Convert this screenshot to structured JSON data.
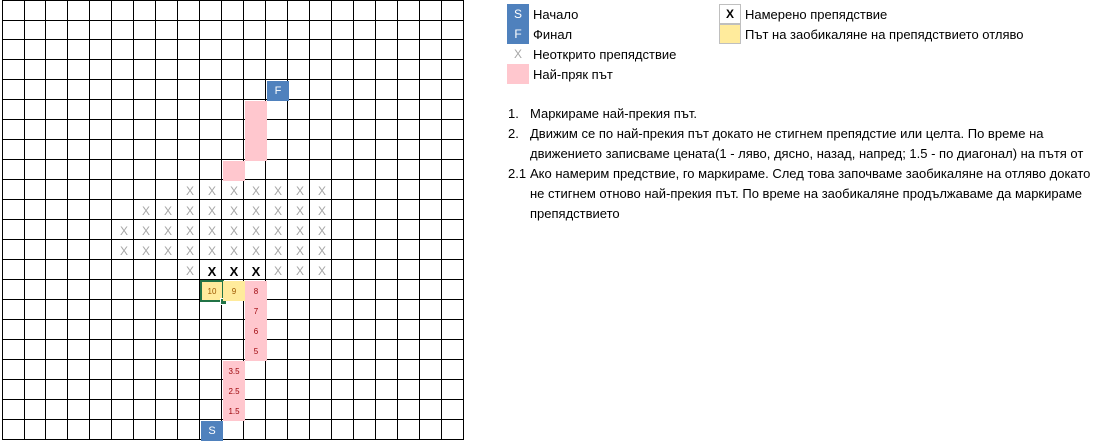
{
  "grid": {
    "rows": 22,
    "cols": 21,
    "cells": [
      {
        "row": 4,
        "col": 12,
        "kind": "end",
        "text": "F"
      },
      {
        "row": 5,
        "col": 11,
        "kind": "pink",
        "text": ""
      },
      {
        "row": 6,
        "col": 11,
        "kind": "pink",
        "text": ""
      },
      {
        "row": 7,
        "col": 11,
        "kind": "pink",
        "text": ""
      },
      {
        "row": 8,
        "col": 10,
        "kind": "pink",
        "text": ""
      },
      {
        "row": 9,
        "col": 8,
        "kind": "unknown",
        "text": "X"
      },
      {
        "row": 9,
        "col": 9,
        "kind": "unknown",
        "text": "X"
      },
      {
        "row": 9,
        "col": 10,
        "kind": "unknown",
        "text": "X"
      },
      {
        "row": 9,
        "col": 11,
        "kind": "unknown",
        "text": "X"
      },
      {
        "row": 9,
        "col": 12,
        "kind": "unknown",
        "text": "X"
      },
      {
        "row": 9,
        "col": 13,
        "kind": "unknown",
        "text": "X"
      },
      {
        "row": 9,
        "col": 14,
        "kind": "unknown",
        "text": "X"
      },
      {
        "row": 10,
        "col": 6,
        "kind": "unknown",
        "text": "X"
      },
      {
        "row": 10,
        "col": 7,
        "kind": "unknown",
        "text": "X"
      },
      {
        "row": 10,
        "col": 8,
        "kind": "unknown",
        "text": "X"
      },
      {
        "row": 10,
        "col": 9,
        "kind": "unknown",
        "text": "X"
      },
      {
        "row": 10,
        "col": 10,
        "kind": "unknown",
        "text": "X"
      },
      {
        "row": 10,
        "col": 11,
        "kind": "unknown",
        "text": "X"
      },
      {
        "row": 10,
        "col": 12,
        "kind": "unknown",
        "text": "X"
      },
      {
        "row": 10,
        "col": 13,
        "kind": "unknown",
        "text": "X"
      },
      {
        "row": 10,
        "col": 14,
        "kind": "unknown",
        "text": "X"
      },
      {
        "row": 11,
        "col": 5,
        "kind": "unknown",
        "text": "X"
      },
      {
        "row": 11,
        "col": 6,
        "kind": "unknown",
        "text": "X"
      },
      {
        "row": 11,
        "col": 7,
        "kind": "unknown",
        "text": "X"
      },
      {
        "row": 11,
        "col": 8,
        "kind": "unknown",
        "text": "X"
      },
      {
        "row": 11,
        "col": 9,
        "kind": "unknown",
        "text": "X"
      },
      {
        "row": 11,
        "col": 10,
        "kind": "unknown",
        "text": "X"
      },
      {
        "row": 11,
        "col": 11,
        "kind": "unknown",
        "text": "X"
      },
      {
        "row": 11,
        "col": 12,
        "kind": "unknown",
        "text": "X"
      },
      {
        "row": 11,
        "col": 13,
        "kind": "unknown",
        "text": "X"
      },
      {
        "row": 11,
        "col": 14,
        "kind": "unknown",
        "text": "X"
      },
      {
        "row": 12,
        "col": 5,
        "kind": "unknown",
        "text": "X"
      },
      {
        "row": 12,
        "col": 6,
        "kind": "unknown",
        "text": "X"
      },
      {
        "row": 12,
        "col": 7,
        "kind": "unknown",
        "text": "X"
      },
      {
        "row": 12,
        "col": 8,
        "kind": "unknown",
        "text": "X"
      },
      {
        "row": 12,
        "col": 9,
        "kind": "unknown",
        "text": "X"
      },
      {
        "row": 12,
        "col": 10,
        "kind": "unknown",
        "text": "X"
      },
      {
        "row": 12,
        "col": 11,
        "kind": "unknown",
        "text": "X"
      },
      {
        "row": 12,
        "col": 12,
        "kind": "unknown",
        "text": "X"
      },
      {
        "row": 12,
        "col": 13,
        "kind": "unknown",
        "text": "X"
      },
      {
        "row": 12,
        "col": 14,
        "kind": "unknown",
        "text": "X"
      },
      {
        "row": 13,
        "col": 8,
        "kind": "unknown",
        "text": "X"
      },
      {
        "row": 13,
        "col": 9,
        "kind": "found",
        "text": "X"
      },
      {
        "row": 13,
        "col": 10,
        "kind": "found",
        "text": "X"
      },
      {
        "row": 13,
        "col": 11,
        "kind": "found",
        "text": "X"
      },
      {
        "row": 13,
        "col": 12,
        "kind": "unknown",
        "text": "X"
      },
      {
        "row": 13,
        "col": 13,
        "kind": "unknown",
        "text": "X"
      },
      {
        "row": 13,
        "col": 14,
        "kind": "unknown",
        "text": "X"
      },
      {
        "row": 14,
        "col": 9,
        "kind": "yellow",
        "text": "10",
        "selected": true
      },
      {
        "row": 14,
        "col": 10,
        "kind": "yellow",
        "text": "9"
      },
      {
        "row": 14,
        "col": 11,
        "kind": "pink",
        "text": "8"
      },
      {
        "row": 15,
        "col": 11,
        "kind": "pink",
        "text": "7"
      },
      {
        "row": 16,
        "col": 11,
        "kind": "pink",
        "text": "6"
      },
      {
        "row": 17,
        "col": 11,
        "kind": "pink",
        "text": "5"
      },
      {
        "row": 18,
        "col": 10,
        "kind": "pink",
        "text": "3.5"
      },
      {
        "row": 19,
        "col": 10,
        "kind": "pink",
        "text": "2.5"
      },
      {
        "row": 20,
        "col": 10,
        "kind": "pink",
        "text": "1.5"
      },
      {
        "row": 21,
        "col": 9,
        "kind": "start",
        "text": "S"
      }
    ]
  },
  "legend": {
    "start": {
      "symbol": "S",
      "label": "Начало"
    },
    "end": {
      "symbol": "F",
      "label": "Финал"
    },
    "unknown": {
      "symbol": "X",
      "label": "Неоткрито препядствие"
    },
    "shortest": {
      "symbol": "",
      "label": "Най-пряк път"
    },
    "found": {
      "symbol": "X",
      "label": "Намерено препядствие"
    },
    "detour": {
      "symbol": "",
      "label": "Път на заобикаляне на препядствието отляво"
    }
  },
  "steps": [
    {
      "num": "1.",
      "text": "Маркираме най-прекия път."
    },
    {
      "num": "2.",
      "text": "Движим се по най-прекия път  докато не стигнем препядстие или целта. По време на движението записваме цената(1 - ляво, дясно, назад, напред; 1.5 - по диагонал) на пътя от"
    },
    {
      "num": "2.1",
      "text": "Ако намерим предствие, го маркираме. След това започваме заобикаляне на отляво докато не стигнем отново най-прекия път. По време на заобикаляне продължаваме да маркираме препядствието"
    }
  ],
  "colors": {
    "start": "#4f81bd",
    "end": "#4f81bd",
    "shortest_path": "#ffc7ce",
    "detour": "#ffeb9c",
    "unknown_obstacle": "#a6a6a6",
    "found_obstacle": "#000000",
    "gridline": "#000000"
  }
}
